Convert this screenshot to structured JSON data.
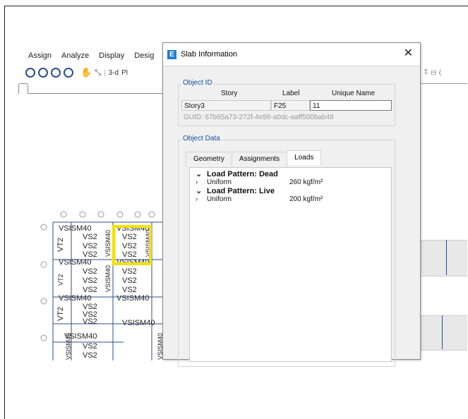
{
  "menu": [
    "Assign",
    "Analyze",
    "Display",
    "Desig"
  ],
  "toolbar": {
    "view3d_label": "3-d",
    "plan_label": "Pl"
  },
  "icons": {
    "zoom": "zoom-icon",
    "pan": "pan-icon",
    "close": "close-icon",
    "app": "etabs-app-icon"
  },
  "colors": {
    "selection": "#f2e200",
    "accent": "#1e7fd6",
    "group_title": "#1a4fa0",
    "model_lines": "#2b4f8c"
  },
  "dialog": {
    "app_icon_letter": "E",
    "title": "Slab Information",
    "close_glyph": "✕",
    "object_id": {
      "title": "Object ID",
      "headers": {
        "story": "Story",
        "label": "Label",
        "unique": "Unique Name"
      },
      "values": {
        "story": "Story3",
        "label": "F25",
        "unique": "11"
      },
      "guid": "GUID:  67b65a73-272f-4e86-a0dc-aaff500bab48"
    },
    "object_data": {
      "title": "Object Data",
      "tabs": [
        "Geometry",
        "Assignments",
        "Loads"
      ],
      "active_tab": "Loads",
      "loads": [
        {
          "pattern": "Load Pattern: Dead",
          "type": "Uniform",
          "value": "260 kgf/m²"
        },
        {
          "pattern": "Load Pattern: Live",
          "type": "Uniform",
          "value": "200 kgf/m²"
        }
      ]
    }
  },
  "model": {
    "col_labels": [
      "VSISM40",
      "VSISM40",
      "VS2",
      "VS2",
      "VS2",
      "VS2",
      "VS2",
      "VS2",
      "VSISM40",
      "VSISM40",
      "VS2",
      "VS2",
      "VS2",
      "VS2",
      "VS2",
      "VS2",
      "VSISM40",
      "VSISM40",
      "VS2",
      "VS2",
      "VSISM40",
      "VSISM40",
      "VS2",
      "VS2"
    ],
    "vert_labels": [
      "VT2",
      "VT2",
      "VT2",
      "VT2",
      "VT2",
      "VT2"
    ]
  }
}
